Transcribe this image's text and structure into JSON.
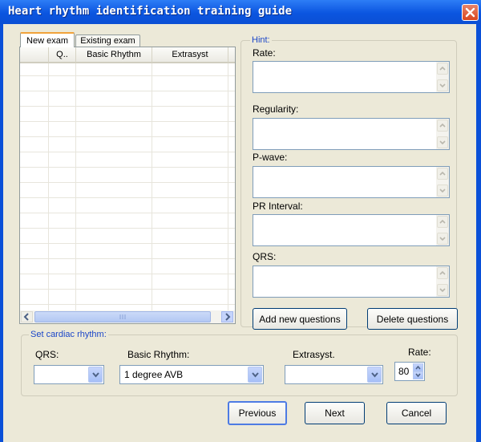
{
  "window": {
    "title": "Heart rhythm identification training guide"
  },
  "tabs": [
    {
      "label": "New exam",
      "active": true
    },
    {
      "label": "Existing exam",
      "active": false
    }
  ],
  "grid": {
    "columns": [
      "Q..",
      "Basic Rhythm",
      "Extrasyst"
    ],
    "rows": []
  },
  "hint": {
    "title": "Hint:",
    "fields": [
      {
        "label": "Rate:",
        "value": ""
      },
      {
        "label": "Regularity:",
        "value": ""
      },
      {
        "label": "P-wave:",
        "value": ""
      },
      {
        "label": "PR Interval:",
        "value": ""
      },
      {
        "label": "QRS:",
        "value": ""
      }
    ]
  },
  "question_buttons": {
    "add": "Add new questions",
    "delete": "Delete questions"
  },
  "cardiac": {
    "title": "Set cardiac rhythm:",
    "qrs_label": "QRS:",
    "qrs_value": "",
    "basic_label": "Basic Rhythm:",
    "basic_value": "1 degree AVB",
    "extrasyst_label": "Extrasyst.",
    "extrasyst_value": "",
    "rate_label": "Rate:",
    "rate_value": "80"
  },
  "nav": {
    "previous": "Previous",
    "next": "Next",
    "cancel": "Cancel"
  },
  "icons": {
    "close": "close-icon",
    "dropdown": "chevron-down-icon",
    "spin_up": "chevron-up-icon",
    "spin_down": "chevron-down-icon",
    "scroll_left": "arrow-left-icon",
    "scroll_right": "arrow-right-icon"
  },
  "colors": {
    "titlebar": "#0b55e0",
    "close": "#d9461f",
    "group_label": "#1b46c8",
    "dialog_bg": "#ece9d8"
  }
}
